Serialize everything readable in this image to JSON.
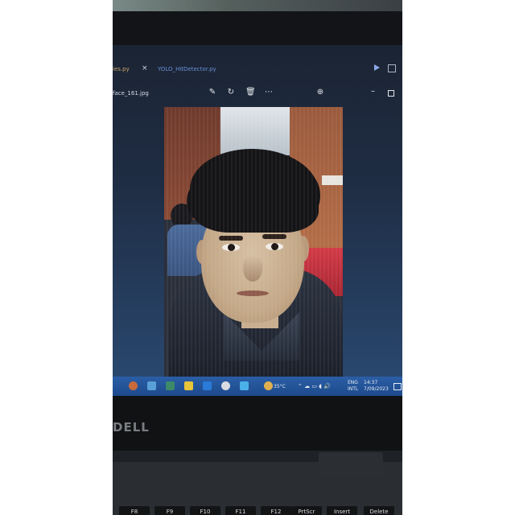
{
  "editor": {
    "tab_active": "ies.py",
    "tab_second": "YOLO_HitDetector.py",
    "file_name": "face_161.jpg",
    "toolbar_icons": [
      "edit-icon",
      "rotate-icon",
      "delete-icon",
      "more-icon",
      "zoom-in-icon"
    ]
  },
  "taskbar": {
    "temperature": "35°C",
    "language_line1": "ENG",
    "language_line2": "INTL",
    "time": "14:37",
    "date": "7/09/2023"
  },
  "laptop": {
    "brand": "DELL"
  },
  "keyboard": {
    "keys": [
      "F8",
      "F9",
      "F10",
      "F11",
      "F12",
      "PrtScr",
      "Insert",
      "Delete"
    ]
  }
}
